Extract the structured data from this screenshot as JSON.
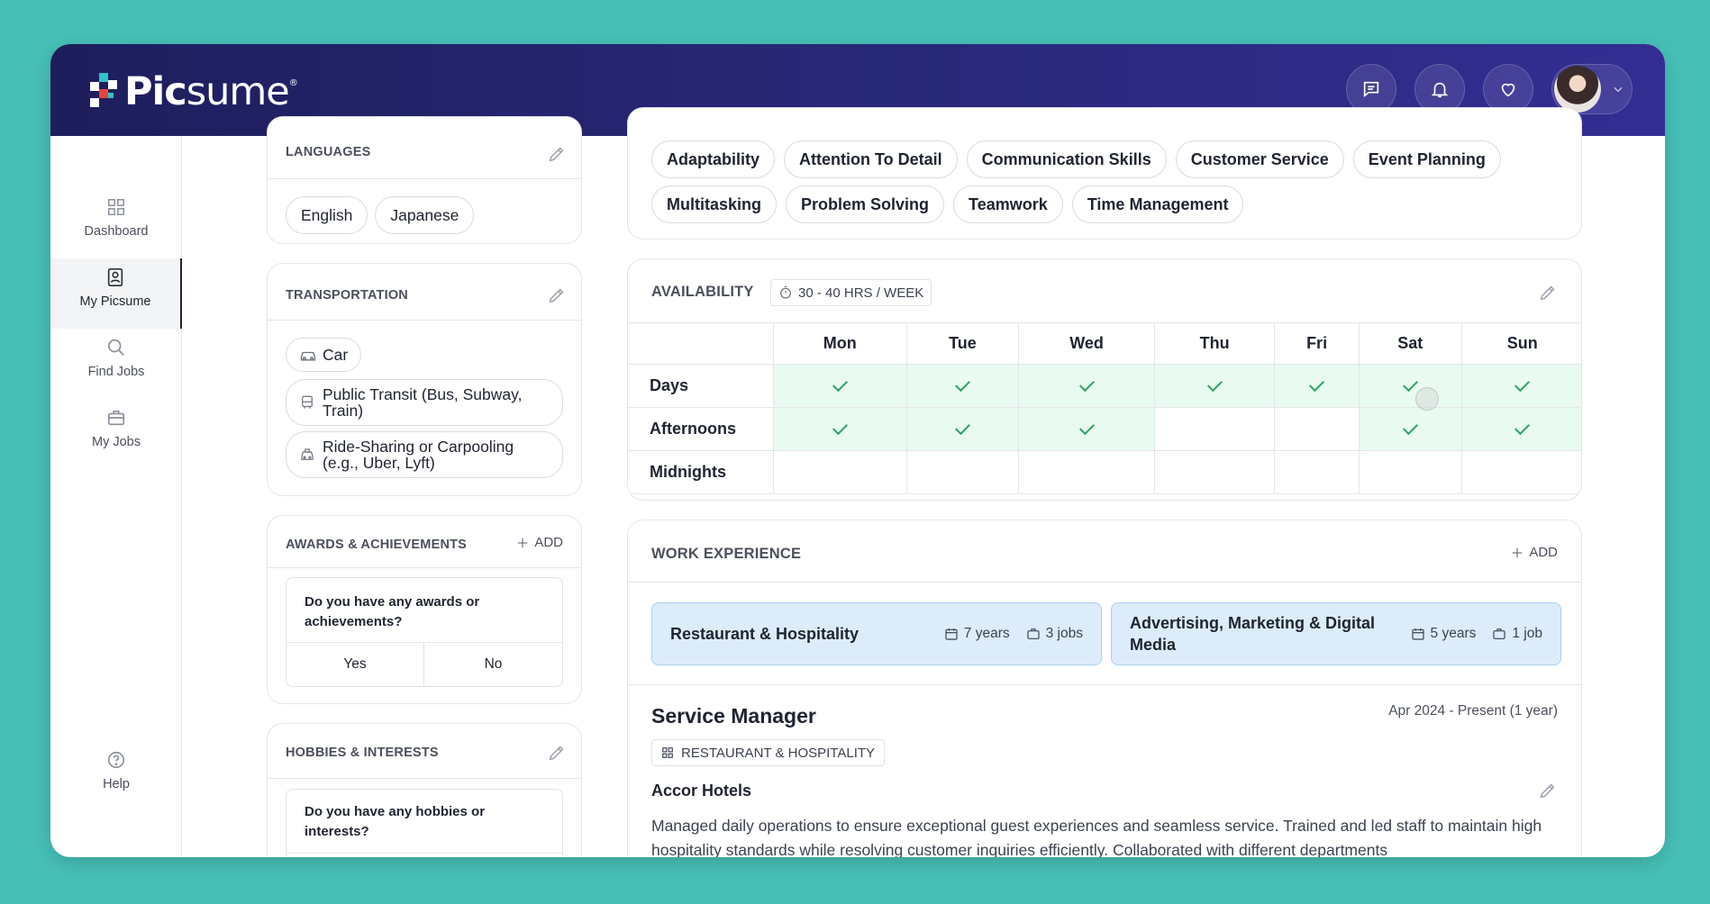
{
  "brand": {
    "name_bold": "Pic",
    "name_light": "sume",
    "registered": "®"
  },
  "header": {
    "icons": [
      "chat-icon",
      "bell-icon",
      "heart-icon"
    ],
    "avatar": "avatar"
  },
  "sidebar": {
    "items": [
      {
        "label": "Dashboard",
        "icon": "grid-icon"
      },
      {
        "label": "My Picsume",
        "icon": "resume-icon"
      },
      {
        "label": "Find Jobs",
        "icon": "search-icon"
      },
      {
        "label": "My Jobs",
        "icon": "briefcase-icon"
      }
    ],
    "help": "Help"
  },
  "languages": {
    "title": "LANGUAGES",
    "items": [
      "English",
      "Japanese"
    ]
  },
  "transportation": {
    "title": "TRANSPORTATION",
    "items": [
      {
        "label": "Car",
        "icon": "car-icon"
      },
      {
        "label": "Public Transit (Bus, Subway, Train)",
        "icon": "bus-icon"
      },
      {
        "label": "Ride-Sharing or Carpooling (e.g., Uber, Lyft)",
        "icon": "taxi-icon"
      }
    ]
  },
  "awards": {
    "title": "AWARDS & ACHIEVEMENTS",
    "add": "ADD",
    "question": "Do you have any awards or achievements?",
    "yes": "Yes",
    "no": "No"
  },
  "hobbies": {
    "title": "HOBBIES & INTERESTS",
    "question": "Do you have any hobbies or interests?"
  },
  "skills": {
    "row1": [
      "Adaptability",
      "Attention To Detail",
      "Communication Skills",
      "Customer Service",
      "Event Planning"
    ],
    "row2": [
      "Multitasking",
      "Problem Solving",
      "Teamwork",
      "Time Management"
    ]
  },
  "availability": {
    "title": "AVAILABILITY",
    "hours": "30 - 40 HRS / WEEK",
    "days": [
      "Mon",
      "Tue",
      "Wed",
      "Thu",
      "Fri",
      "Sat",
      "Sun"
    ],
    "rows": [
      {
        "label": "Days",
        "available": [
          true,
          true,
          true,
          true,
          true,
          true,
          true
        ]
      },
      {
        "label": "Afternoons",
        "available": [
          true,
          true,
          true,
          false,
          false,
          true,
          true
        ]
      },
      {
        "label": "Midnights",
        "available": [
          false,
          false,
          false,
          false,
          false,
          false,
          false
        ]
      }
    ]
  },
  "work": {
    "title": "WORK EXPERIENCE",
    "add": "ADD",
    "categories": [
      {
        "name": "Restaurant & Hospitality",
        "years": "7 years",
        "jobs": "3 jobs"
      },
      {
        "name": "Advertising, Marketing & Digital Media",
        "years": "5 years",
        "jobs": "1 job"
      }
    ],
    "job": {
      "title": "Service Manager",
      "dates": "Apr 2024 - Present (1 year)",
      "category": "RESTAURANT & HOSPITALITY",
      "company": "Accor Hotels",
      "description": "Managed daily operations to ensure exceptional guest experiences and seamless service. Trained and led staff to maintain high hospitality standards while resolving customer inquiries efficiently. Collaborated with different departments"
    }
  }
}
